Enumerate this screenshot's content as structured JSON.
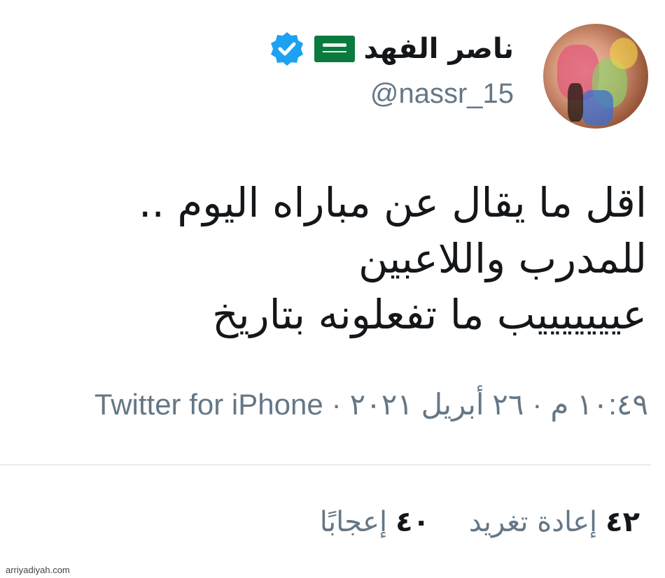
{
  "user": {
    "display_name": "ناصر الفهد",
    "handle": "@nassr_15",
    "avatar_icon": "avatar-photo",
    "flag_icon": "saudi-flag-icon",
    "verified_icon": "verified-badge-icon",
    "verified_color": "#1da1f2"
  },
  "tweet": {
    "lines": [
      "اقل ما يقال عن مباراه اليوم ..",
      "للمدرب واللاعبين",
      "عيييييييب ما تفعلونه بتاريخ"
    ]
  },
  "meta": {
    "time": "١٠:٤٩ م",
    "date": "٢٦ أبريل ٢٠٢١",
    "separator": "·",
    "source": "Twitter for iPhone"
  },
  "stats": {
    "retweets_count": "٤٢",
    "retweets_label": "إعادة تغريد",
    "likes_count": "٤٠",
    "likes_label": "إعجابًا"
  },
  "watermark": "arriyadiyah.com",
  "colors": {
    "text": "#14171a",
    "secondary": "#657786",
    "divider": "#e6ecf0",
    "flag_green": "#0b7a3e"
  }
}
